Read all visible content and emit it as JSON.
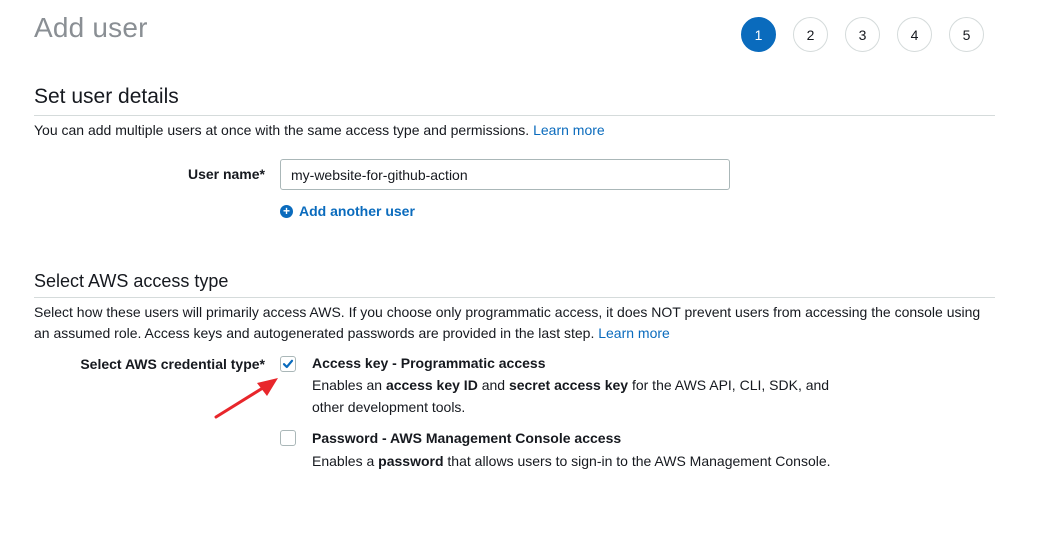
{
  "page": {
    "title": "Add user"
  },
  "steps": [
    "1",
    "2",
    "3",
    "4",
    "5"
  ],
  "active_step": "1",
  "user_details": {
    "section_title": "Set user details",
    "description": "You can add multiple users at once with the same access type and permissions.",
    "learn_more": "Learn more",
    "user_name_label": "User name*",
    "user_name_value": "my-website-for-github-action",
    "add_another_user": "Add another user"
  },
  "access_type": {
    "section_title": "Select AWS access type",
    "description_line1": "Select how these users will primarily access AWS. If you choose only programmatic access, it does NOT prevent users from accessing the console using",
    "description_line2": "an assumed role. Access keys and autogenerated passwords are provided in the last step.",
    "learn_more": "Learn more",
    "credential_label": "Select AWS credential type*",
    "options": [
      {
        "title": "Access key - Programmatic access",
        "checked": true,
        "desc_parts": [
          "Enables an ",
          "access key ID",
          " and ",
          "secret access key",
          " for the AWS API, CLI, SDK, and",
          "other development tools."
        ]
      },
      {
        "title": "Password - AWS Management Console access",
        "checked": false,
        "desc_parts": [
          "Enables a ",
          "password",
          " that allows users to sign-in to the AWS Management Console."
        ]
      }
    ]
  },
  "colors": {
    "accent": "#0a6bbd",
    "annotation_arrow": "#e8262b"
  },
  "icons": {
    "add_user": "plus-circle-icon",
    "checkbox_checked": "checkmark-icon",
    "annotation": "red-arrow-icon"
  }
}
